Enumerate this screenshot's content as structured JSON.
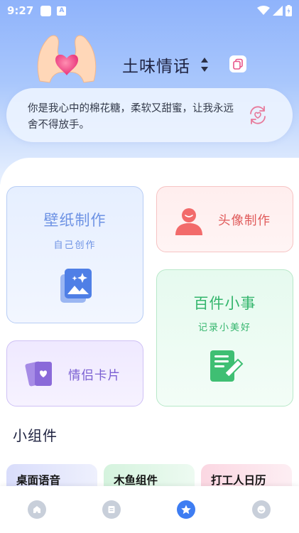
{
  "status_bar": {
    "time": "9:27"
  },
  "header": {
    "title": "土味情话",
    "quote": "你是我心中的棉花糖，柔软又甜蜜，让我永远舍不得放手。"
  },
  "cards": {
    "wallpaper": {
      "title": "壁纸制作",
      "subtitle": "自己创作"
    },
    "avatar": {
      "title": "头像制作"
    },
    "events": {
      "title": "百件小事",
      "subtitle": "记录小美好"
    },
    "couple_card": {
      "title": "情侣卡片"
    }
  },
  "widgets_section": {
    "title": "小组件",
    "items": [
      {
        "label": "桌面语音"
      },
      {
        "label": "木鱼组件"
      },
      {
        "label": "打工人日历"
      }
    ]
  },
  "tabbar": {
    "tabs": [
      {
        "icon": "home-icon",
        "active": false
      },
      {
        "icon": "document-icon",
        "active": false
      },
      {
        "icon": "star-icon",
        "active": true
      },
      {
        "icon": "smile-icon",
        "active": false
      }
    ]
  },
  "colors": {
    "accent": "#3e7df2",
    "wallpaper": "#6d92e4",
    "avatar": "#e05a5a",
    "events": "#33b56c",
    "couple": "#7a5fd2"
  }
}
